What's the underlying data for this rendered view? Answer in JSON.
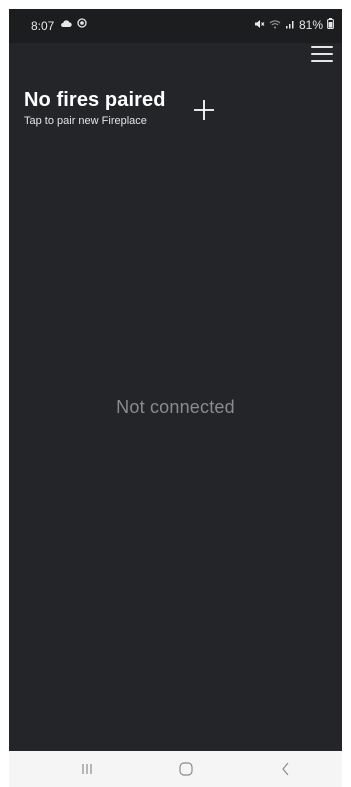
{
  "status_bar": {
    "time": "8:07",
    "battery": "81%",
    "left_icons": [
      "cloud-icon",
      "record-icon"
    ],
    "right_icons": [
      "mute-icon",
      "wifi-icon",
      "signal-icon",
      "battery-icon"
    ]
  },
  "header": {
    "title": "No fires paired",
    "subtitle": "Tap to pair new Fireplace",
    "add_icon": "plus-icon",
    "menu_icon": "hamburger-menu-icon"
  },
  "main": {
    "status_text": "Not connected"
  },
  "nav_bar": {
    "items": [
      "recent-apps-icon",
      "home-icon",
      "back-icon"
    ]
  },
  "colors": {
    "background": "#232528",
    "status_bar": "#1c1d1f",
    "status_text": "#8a8b8d",
    "nav_bar": "#f5f5f6"
  }
}
